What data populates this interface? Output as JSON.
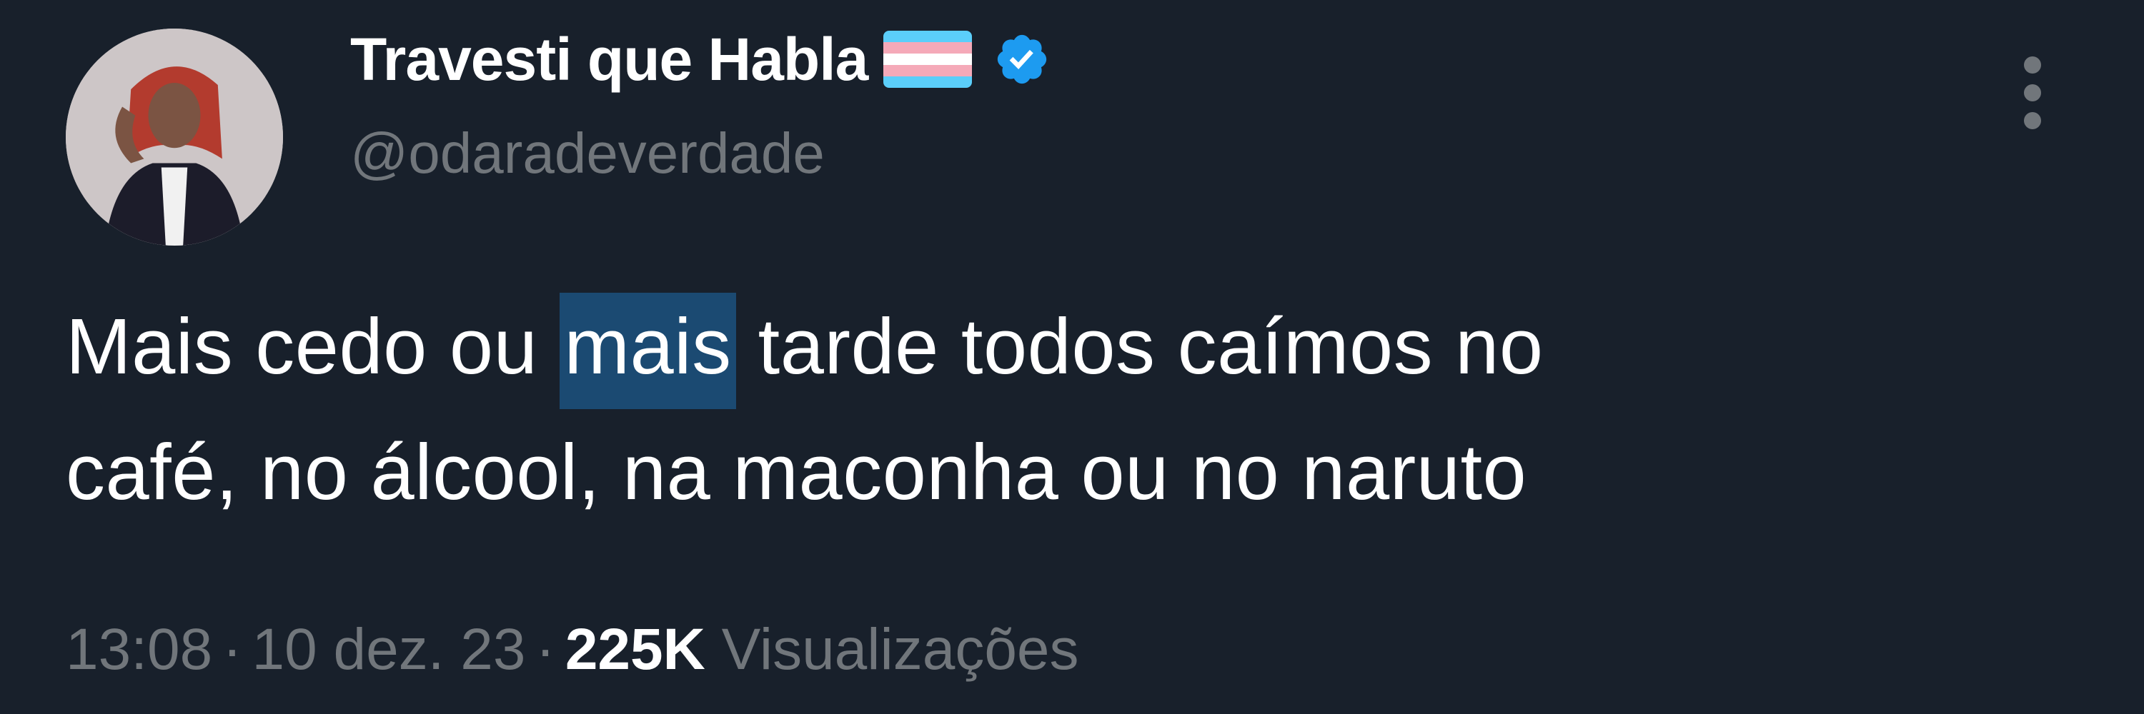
{
  "author": {
    "display_name": "Travesti que Habla",
    "handle": "@odaradeverdade",
    "flag_icon": "transgender-flag-icon",
    "verified_icon": "verified-badge-icon",
    "verified_color": "#1d9bf0"
  },
  "tweet": {
    "line1_before": "Mais cedo ou ",
    "line1_highlight": "mais",
    "line1_after": " tarde todos caímos no",
    "line2": "café, no álcool, na maconha ou no naruto"
  },
  "meta": {
    "time": "13:08",
    "separator": "·",
    "date": "10 dez. 23",
    "views_count": "225K",
    "views_label": "Visualizações"
  },
  "menu": {
    "icon": "more-vertical-icon"
  },
  "colors": {
    "background": "#18202b",
    "text_primary": "#ffffff",
    "text_secondary": "#71767b",
    "highlight": "#1b4a72",
    "accent": "#1d9bf0"
  }
}
